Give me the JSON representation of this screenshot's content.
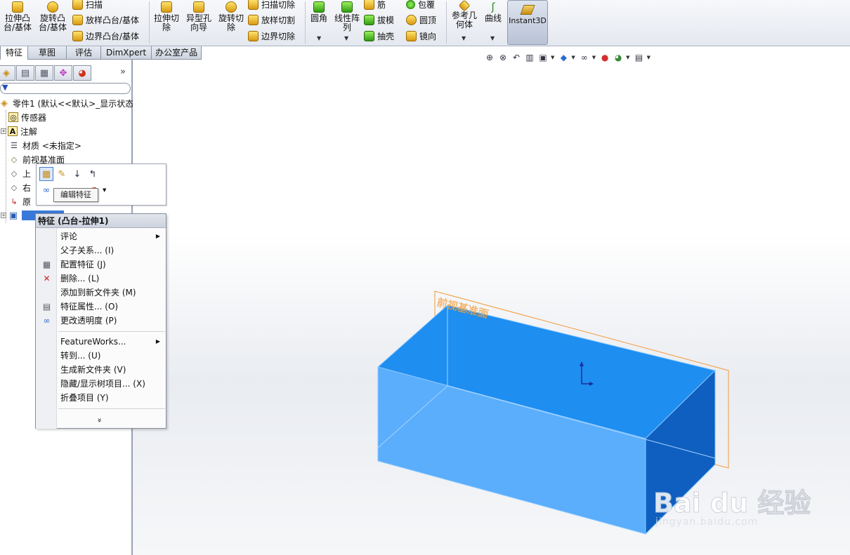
{
  "ribbon": {
    "extrude_boss": "拉伸凸\n台/基体",
    "revolve_boss": "旋转凸\n台/基体",
    "sweep": "扫描",
    "loft_boss": "放样凸台/基体",
    "boundary_boss": "边界凸台/基体",
    "extrude_cut": "拉伸切\n除",
    "hole_wizard": "异型孔\n向导",
    "revolve_cut": "旋转切\n除",
    "swept_cut": "扫描切除",
    "lofted_cut": "放样切割",
    "boundary_cut": "边界切除",
    "fillet": "圆角",
    "linear_pattern": "线性阵\n列",
    "rib": "筋",
    "draft": "拔模",
    "shell": "抽壳",
    "wrap": "包覆",
    "dome": "圆顶",
    "mirror": "镜向",
    "ref_geometry": "参考几\n何体",
    "curves": "曲线",
    "instant3d": "Instant3D"
  },
  "tabs": [
    "特征",
    "草图",
    "评估",
    "DimXpert",
    "办公室产品"
  ],
  "tree": {
    "root": "零件1 (默认<<默认>_显示状态",
    "sensors": "传感器",
    "annotations": "注解",
    "material": "材质 <未指定>",
    "front_plane": "前视基准面",
    "top_plane_partial": "上",
    "right_plane_partial": "右",
    "origin_partial": "原"
  },
  "tooltip": "编辑特征",
  "context_menu": {
    "header": "特征 (凸台-拉伸1)",
    "items": [
      {
        "label": "评论",
        "submenu": true
      },
      {
        "label": "父子关系... (I)"
      },
      {
        "label": "配置特征 (J)"
      },
      {
        "label": "删除... (L)"
      },
      {
        "label": "添加到新文件夹 (M)"
      },
      {
        "label": "特征属性... (O)"
      },
      {
        "label": "更改透明度 (P)"
      },
      {
        "label": "FeatureWorks...",
        "submenu": true
      },
      {
        "label": "转到... (U)"
      },
      {
        "label": "生成新文件夹 (V)"
      },
      {
        "label": "隐藏/显示树项目... (X)"
      },
      {
        "label": "折叠项目 (Y)"
      }
    ],
    "more": "»"
  },
  "viewport": {
    "plane_label": "前视基准面",
    "body_color_top": "#1e8ef0",
    "body_color_front": "#5aaefc",
    "body_color_side": "#0f5fc0",
    "plane_color": "#f39a3a"
  },
  "watermark": {
    "logo": "Bai du 经验",
    "sub": "jingyan.baidu.com"
  }
}
